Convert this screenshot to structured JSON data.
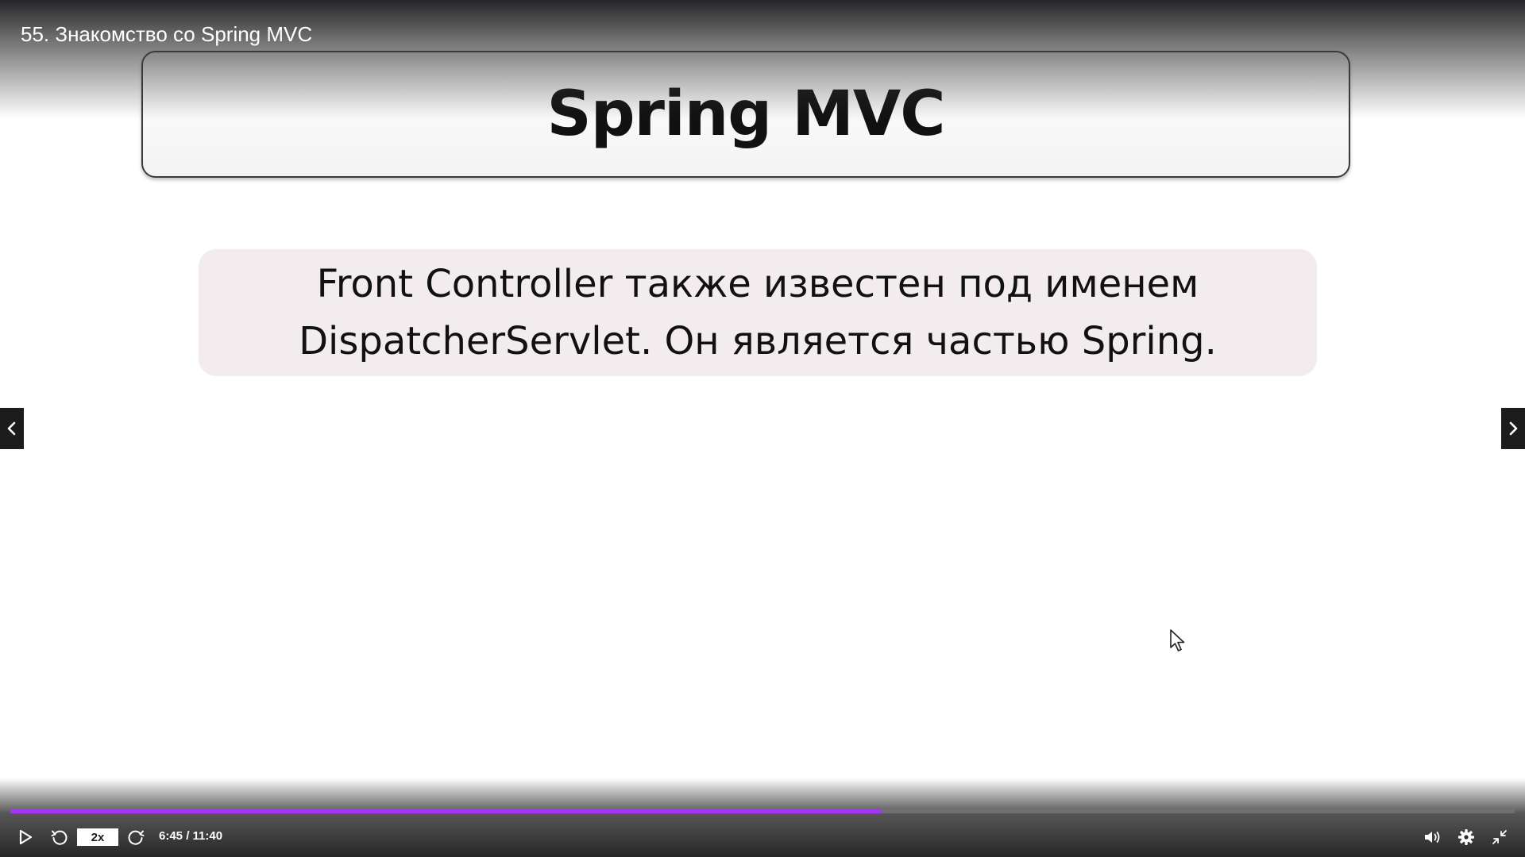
{
  "player": {
    "title": "55. Знакомство со Spring MVC",
    "accent_color": "#a435f0"
  },
  "slide": {
    "title": "Spring MVC",
    "note_line1": "Front Controller также известен под именем",
    "note_line2": "DispatcherServlet. Он является частью Spring."
  },
  "controls": {
    "play_icon": "play-icon",
    "rewind_icon": "rewind-icon",
    "forward_icon": "forward-icon",
    "speed_label": "2x",
    "time_current": "6:45",
    "time_separator": " / ",
    "time_total": "11:40",
    "progress_fraction": 0.579,
    "volume_icon": "volume-icon",
    "settings_icon": "settings-icon",
    "exit_fullscreen_icon": "exit-fullscreen-icon"
  },
  "navigation": {
    "prev_icon": "chevron-left-icon",
    "next_icon": "chevron-right-icon"
  }
}
